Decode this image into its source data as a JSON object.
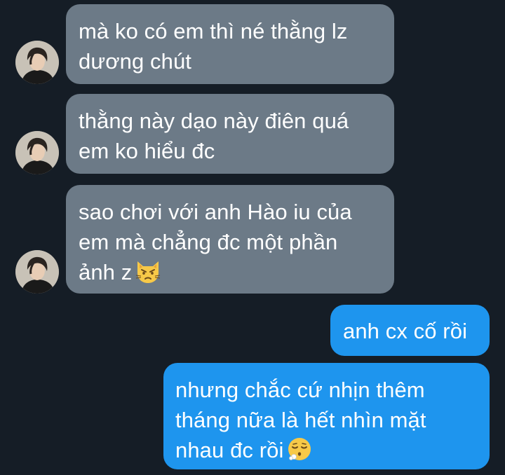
{
  "conversation": {
    "incoming": [
      {
        "lines": [
          "mà ko có em thì né thằng lz",
          "dương chút"
        ]
      },
      {
        "lines": [
          "thằng này dạo này điên quá",
          "em ko hiểu đc"
        ]
      },
      {
        "lines": [
          "sao chơi với anh Hào iu của",
          "em mà chẳng đc một phần",
          "ảnh z"
        ],
        "emoji": "pouting-cat-emoji"
      }
    ],
    "outgoing": [
      {
        "lines": [
          "anh cx cố rồi"
        ]
      },
      {
        "lines": [
          "nhưng chắc cứ nhịn thêm",
          "tháng nữa là hết nhìn mặt",
          "nhau đc rồi"
        ],
        "emoji": "exhaling-face-emoji"
      }
    ]
  },
  "colors": {
    "background": "#151d26",
    "incoming_bubble": "#6c7a87",
    "outgoing_bubble": "#1e95ee",
    "text": "#ffffff"
  }
}
